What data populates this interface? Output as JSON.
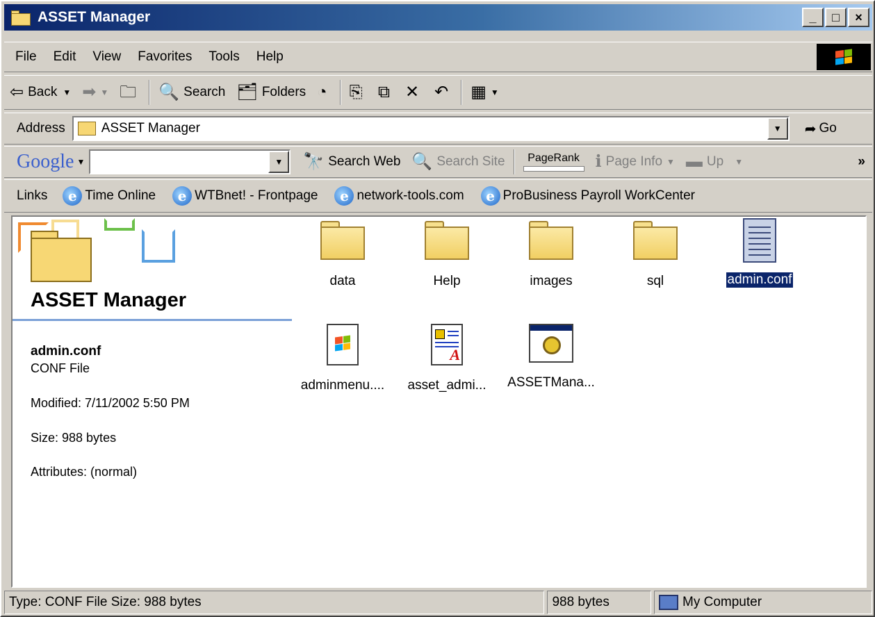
{
  "window": {
    "title": "ASSET Manager",
    "controls": {
      "minimize": "_",
      "maximize": "□",
      "close": "×"
    }
  },
  "menu": [
    "File",
    "Edit",
    "View",
    "Favorites",
    "Tools",
    "Help"
  ],
  "toolbar": {
    "back": "Back",
    "search": "Search",
    "folders": "Folders"
  },
  "address": {
    "label": "Address",
    "value": "ASSET Manager",
    "go": "Go"
  },
  "google": {
    "logo": "Google",
    "search_value": "",
    "search_web": "Search Web",
    "search_site": "Search Site",
    "pagerank": "PageRank",
    "page_info": "Page Info",
    "up": "Up",
    "more": "»"
  },
  "links": {
    "label": "Links",
    "items": [
      "Time Online",
      "WTBnet! - Frontpage",
      "network-tools.com",
      "ProBusiness Payroll WorkCenter"
    ]
  },
  "panel": {
    "title": "ASSET Manager",
    "selected_name": "admin.conf",
    "selected_type": "CONF File",
    "modified": "Modified: 7/11/2002 5:50 PM",
    "size": "Size: 988 bytes",
    "attributes": "Attributes: (normal)"
  },
  "files": [
    {
      "name": "data",
      "icon": "folder-icon"
    },
    {
      "name": "Help",
      "icon": "folder-icon"
    },
    {
      "name": "images",
      "icon": "folder-icon"
    },
    {
      "name": "sql",
      "icon": "folder-icon"
    },
    {
      "name": "admin.conf",
      "icon": "notepad-file-icon",
      "selected": true
    },
    {
      "name": "adminmenu....",
      "icon": "windows-file-icon"
    },
    {
      "name": "asset_admi...",
      "icon": "document-file-icon"
    },
    {
      "name": "ASSETMana...",
      "icon": "executable-icon"
    }
  ],
  "status": {
    "info": "Type: CONF File Size: 988 bytes",
    "size": "988 bytes",
    "zone": "My Computer"
  },
  "colors": {
    "title_start": "#0a246a",
    "title_end": "#a6caf0",
    "selection": "#0a246a",
    "chrome": "#d4d0c8"
  }
}
